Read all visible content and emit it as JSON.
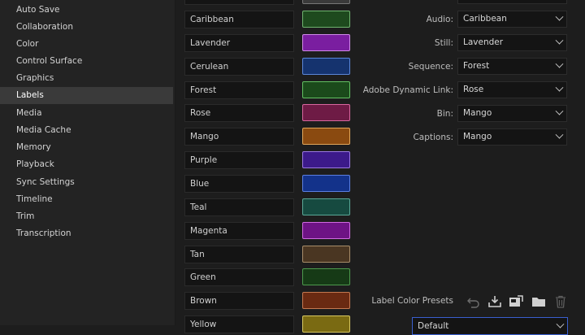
{
  "sidebar": {
    "items": [
      {
        "label": "Auto Save"
      },
      {
        "label": "Collaboration"
      },
      {
        "label": "Color"
      },
      {
        "label": "Control Surface"
      },
      {
        "label": "Graphics"
      },
      {
        "label": "Labels",
        "selected": true
      },
      {
        "label": "Media"
      },
      {
        "label": "Media Cache"
      },
      {
        "label": "Memory"
      },
      {
        "label": "Playback"
      },
      {
        "label": "Sync Settings"
      },
      {
        "label": "Timeline"
      },
      {
        "label": "Trim"
      },
      {
        "label": "Transcription"
      }
    ]
  },
  "labels": [
    {
      "name": "Caribbean",
      "color": "#1e4a1e",
      "border": "#6fb46f"
    },
    {
      "name": "Lavender",
      "color": "#7a1ea0",
      "border": "#d08ae8"
    },
    {
      "name": "Cerulean",
      "color": "#15336e",
      "border": "#5b86d8"
    },
    {
      "name": "Forest",
      "color": "#1b4a1b",
      "border": "#62c062"
    },
    {
      "name": "Rose",
      "color": "#6e1b45",
      "border": "#d8679e"
    },
    {
      "name": "Mango",
      "color": "#8a4a10",
      "border": "#e2a65a"
    },
    {
      "name": "Purple",
      "color": "#3c1a8a",
      "border": "#9a78e0"
    },
    {
      "name": "Blue",
      "color": "#13328a",
      "border": "#5b7fe0"
    },
    {
      "name": "Teal",
      "color": "#164a40",
      "border": "#5aa897"
    },
    {
      "name": "Magenta",
      "color": "#6e1385",
      "border": "#cf6ae0"
    },
    {
      "name": "Tan",
      "color": "#4a3622",
      "border": "#a88d6a"
    },
    {
      "name": "Green",
      "color": "#163a16",
      "border": "#4d9a4d"
    },
    {
      "name": "Brown",
      "color": "#6a2a12",
      "border": "#c47850"
    },
    {
      "name": "Yellow",
      "color": "#7a6a12",
      "border": "#d8c860"
    }
  ],
  "assignments": [
    {
      "label": "Audio:",
      "value": "Caribbean"
    },
    {
      "label": "Still:",
      "value": "Lavender"
    },
    {
      "label": "Sequence:",
      "value": "Forest"
    },
    {
      "label": "Adobe Dynamic Link:",
      "value": "Rose"
    },
    {
      "label": "Bin:",
      "value": "Mango"
    },
    {
      "label": "Captions:",
      "value": "Mango"
    }
  ],
  "presets": {
    "label": "Label Color Presets",
    "icons": [
      "undo-icon",
      "import-icon",
      "save-preset-icon",
      "folder-icon",
      "trash-icon"
    ],
    "selected": "Default"
  }
}
